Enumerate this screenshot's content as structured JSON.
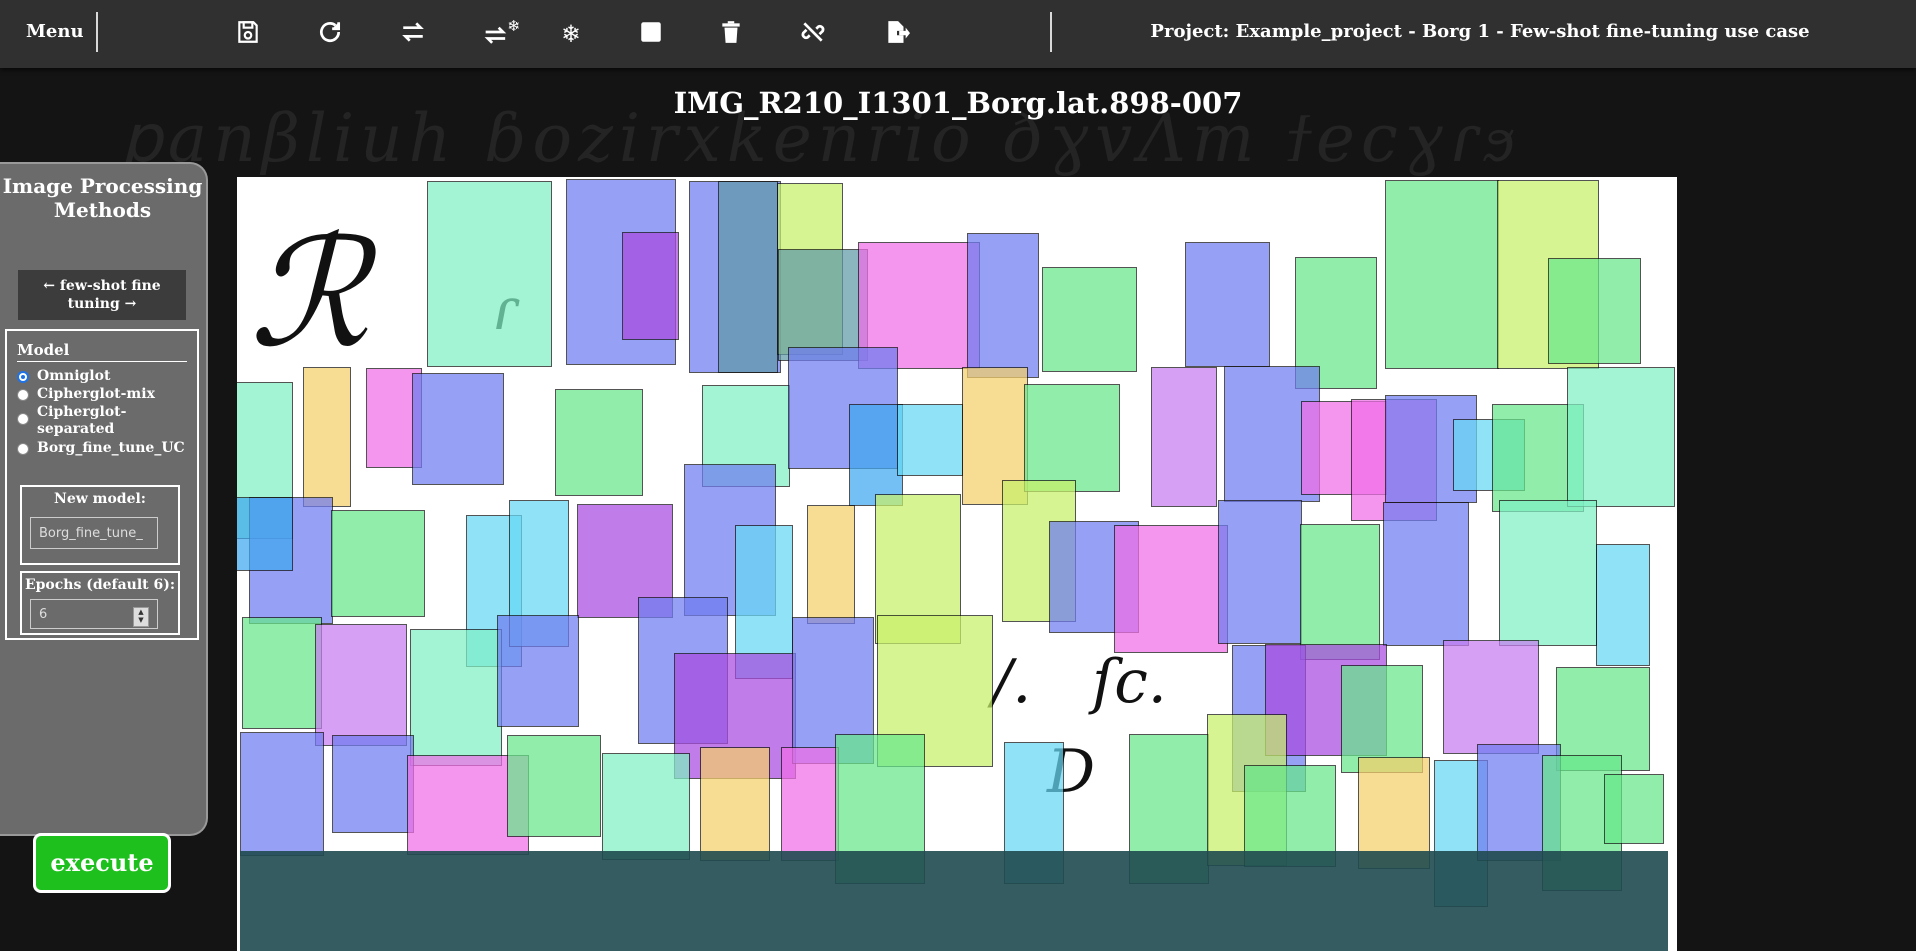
{
  "topbar": {
    "menu_label": "Menu",
    "project_title": "Project: Example_project - Borg 1 - Few-shot fine-tuning use case",
    "tools": [
      {
        "name": "save-icon"
      },
      {
        "name": "redo-icon"
      },
      {
        "name": "swap-icon"
      },
      {
        "name": "swap-freeze-icon"
      },
      {
        "name": "snowflake-icon"
      },
      {
        "name": "stop-square-icon"
      },
      {
        "name": "trash-icon"
      },
      {
        "name": "unlink-icon"
      },
      {
        "name": "export-file-icon"
      }
    ]
  },
  "image_title": "IMG_R210_I1301_Borg.lat.898-007",
  "sidebar": {
    "title": "Image Processing Methods",
    "few_shot_label": "← few-shot fine tuning →",
    "model": {
      "title": "Model",
      "options": [
        "Omniglot",
        "Cipherglot-mix",
        "Cipherglot-separated",
        "Borg_fine_tune_UC"
      ],
      "selected": "Omniglot"
    },
    "new_model": {
      "label": "New model:",
      "value": "Borg_fine_tune_"
    },
    "epochs": {
      "label": "Epochs (default 6):",
      "value": "6"
    },
    "execute_label": "execute"
  },
  "colors": {
    "green": "#66e88a",
    "mint": "#7ff0c4",
    "blue": "#6f7cf0",
    "purple": "#a84ae0",
    "pink": "#f06ee8",
    "lime": "#c8f06a",
    "yellow": "#f5cf6a",
    "cyan": "#66d8f5",
    "execute": "#1ec01e"
  }
}
